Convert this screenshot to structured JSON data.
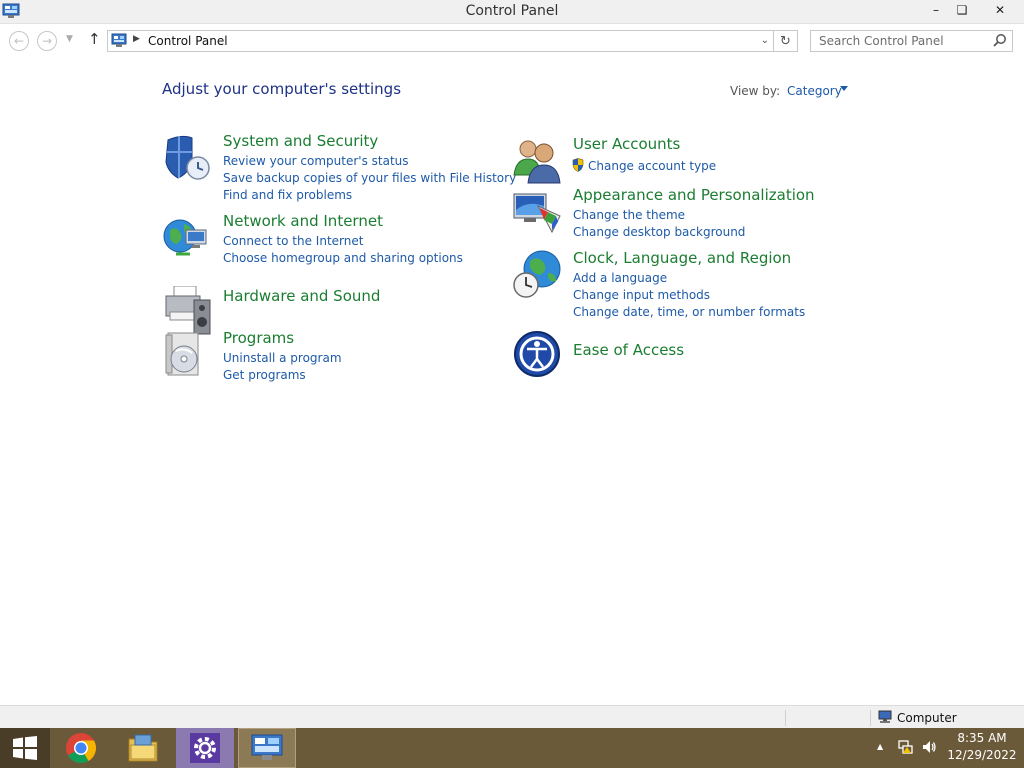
{
  "window": {
    "title": "Control Panel",
    "minimize_label": "–",
    "maximize_label": "❏",
    "close_label": "✕"
  },
  "nav": {
    "back_glyph": "←",
    "forward_glyph": "→",
    "recent_glyph": "▼",
    "up_glyph": "↑",
    "separator_glyph": "▶",
    "breadcrumb": "Control Panel",
    "address_drop_glyph": "⌄",
    "refresh_glyph": "↻",
    "search_placeholder": "Search Control Panel"
  },
  "main": {
    "heading": "Adjust your computer's settings",
    "view_by_label": "View by:",
    "view_by_value": "Category",
    "categories_left": [
      {
        "title": "System and Security",
        "icon": "shield-icon",
        "links": [
          "Review your computer's status",
          "Save backup copies of your files with File History",
          "Find and fix problems"
        ]
      },
      {
        "title": "Network and Internet",
        "icon": "network-globe-icon",
        "links": [
          "Connect to the Internet",
          "Choose homegroup and sharing options"
        ]
      },
      {
        "title": "Hardware and Sound",
        "icon": "printer-speaker-icon",
        "links": []
      },
      {
        "title": "Programs",
        "icon": "programs-disc-icon",
        "links": [
          "Uninstall a program",
          "Get programs"
        ]
      }
    ],
    "categories_right": [
      {
        "title": "User Accounts",
        "icon": "users-icon",
        "links": [
          "Change account type"
        ]
      },
      {
        "title": "Appearance and Personalization",
        "icon": "monitor-palette-icon",
        "links": [
          "Change the theme",
          "Change desktop background"
        ]
      },
      {
        "title": "Clock, Language, and Region",
        "icon": "clock-globe-icon",
        "links": [
          "Add a language",
          "Change input methods",
          "Change date, time, or number formats"
        ]
      },
      {
        "title": "Ease of Access",
        "icon": "ease-of-access-icon",
        "links": []
      }
    ]
  },
  "statusbar": {
    "location": "Computer"
  },
  "taskbar": {
    "apps": [
      "start-button",
      "chrome",
      "file-explorer",
      "settings",
      "control-panel"
    ],
    "time": "8:35 AM",
    "date": "12/29/2022",
    "tray_arrow": "▲"
  },
  "colors": {
    "category_title": "#1b7d32",
    "link": "#1e5aa8",
    "heading": "#1e3287",
    "taskbar": "#6b5a3a"
  }
}
